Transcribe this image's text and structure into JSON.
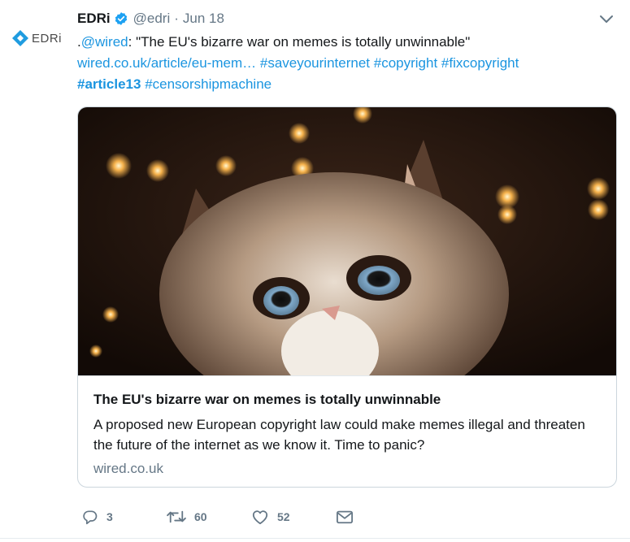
{
  "tweet": {
    "author": {
      "name": "EDRi",
      "handle": "@edri",
      "separator": "·",
      "date": "Jun 18",
      "avatar_text": "EDRi"
    },
    "text": {
      "prefix": ".",
      "mention": "@wired",
      "body": ": \"The EU's bizarre war on memes is totally unwinnable\"",
      "link": "wired.co.uk/article/eu-mem…",
      "hashtags_line1": [
        "#saveyourinternet",
        "#copyright",
        "#fixcopyright"
      ],
      "hashtag_bold": "#article13",
      "hashtag_last": "#censorshipmachine"
    },
    "card": {
      "title": "The EU's bizarre war on memes is totally unwinnable",
      "description": "A proposed new European copyright law could make memes illegal and threaten the future of the internet as we know it. Time to panic?",
      "domain": "wired.co.uk"
    },
    "actions": {
      "replies": "3",
      "retweets": "60",
      "likes": "52"
    },
    "colors": {
      "link": "#1b95e0",
      "secondary": "#657786",
      "verified": "#1da1f2",
      "edri_logo": "#1f9ce0"
    },
    "icons": [
      "verified-badge-icon",
      "caret-down-icon",
      "reply-icon",
      "retweet-icon",
      "like-icon",
      "dm-icon"
    ]
  }
}
